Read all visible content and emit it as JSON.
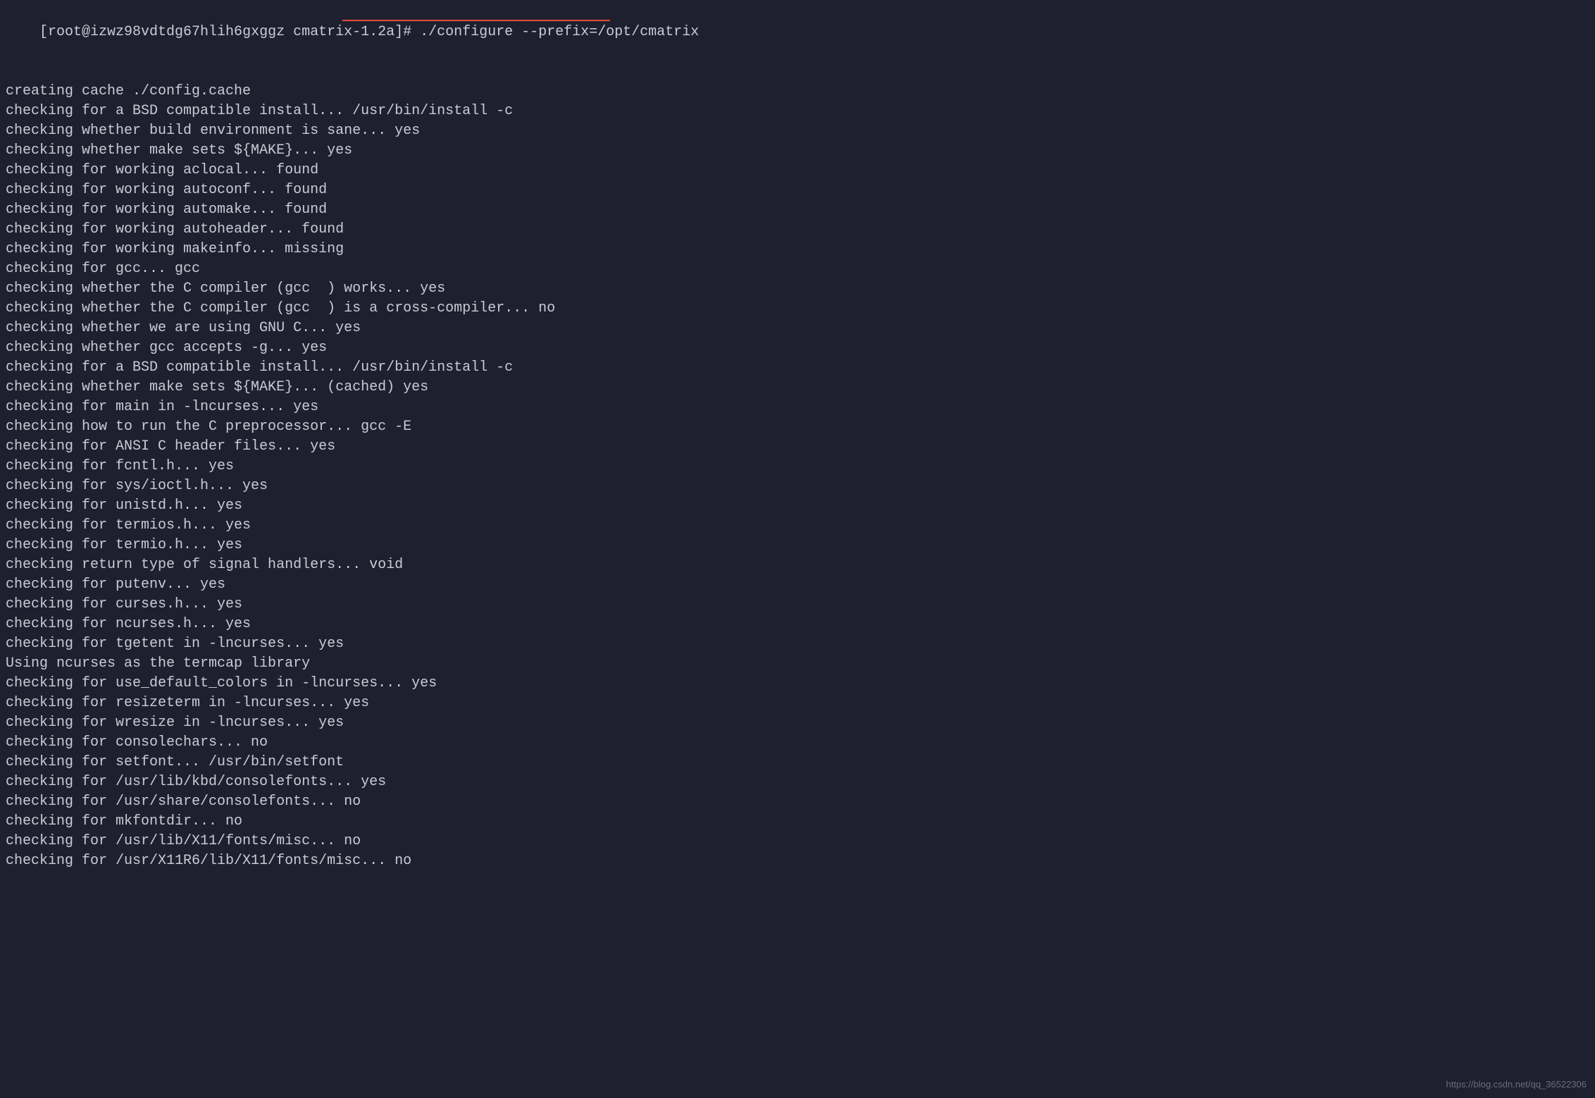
{
  "terminal": {
    "prompt": "[root@izwz98vdtdg67hlih6gxggz cmatrix-1.2a]# ",
    "command": "./configure --prefix=/opt/cmatrix",
    "output_lines": [
      "creating cache ./config.cache",
      "checking for a BSD compatible install... /usr/bin/install -c",
      "checking whether build environment is sane... yes",
      "checking whether make sets ${MAKE}... yes",
      "checking for working aclocal... found",
      "checking for working autoconf... found",
      "checking for working automake... found",
      "checking for working autoheader... found",
      "checking for working makeinfo... missing",
      "checking for gcc... gcc",
      "checking whether the C compiler (gcc  ) works... yes",
      "checking whether the C compiler (gcc  ) is a cross-compiler... no",
      "checking whether we are using GNU C... yes",
      "checking whether gcc accepts -g... yes",
      "checking for a BSD compatible install... /usr/bin/install -c",
      "checking whether make sets ${MAKE}... (cached) yes",
      "checking for main in -lncurses... yes",
      "checking how to run the C preprocessor... gcc -E",
      "checking for ANSI C header files... yes",
      "checking for fcntl.h... yes",
      "checking for sys/ioctl.h... yes",
      "checking for unistd.h... yes",
      "checking for termios.h... yes",
      "checking for termio.h... yes",
      "checking return type of signal handlers... void",
      "checking for putenv... yes",
      "checking for curses.h... yes",
      "checking for ncurses.h... yes",
      "checking for tgetent in -lncurses... yes",
      "Using ncurses as the termcap library",
      "checking for use_default_colors in -lncurses... yes",
      "checking for resizeterm in -lncurses... yes",
      "checking for wresize in -lncurses... yes",
      "checking for consolechars... no",
      "checking for setfont... /usr/bin/setfont",
      "checking for /usr/lib/kbd/consolefonts... yes",
      "checking for /usr/share/consolefonts... no",
      "checking for mkfontdir... no",
      "checking for /usr/lib/X11/fonts/misc... no",
      "checking for /usr/X11R6/lib/X11/fonts/misc... no"
    ]
  },
  "watermark": "https://blog.csdn.net/qq_36522306"
}
